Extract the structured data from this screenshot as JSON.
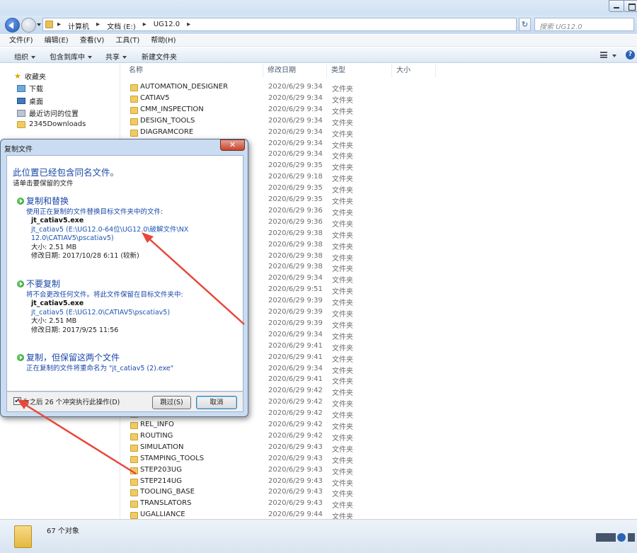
{
  "window": {
    "breadcrumb": [
      "计算机",
      "文档 (E:)",
      "UG12.0"
    ],
    "search_placeholder": "搜索 UG12.0"
  },
  "menu": [
    "文件(F)",
    "编辑(E)",
    "查看(V)",
    "工具(T)",
    "帮助(H)"
  ],
  "toolbar": {
    "organize": "组织",
    "include": "包含到库中",
    "share": "共享",
    "new_folder": "新建文件夹"
  },
  "nav": {
    "favorites": "收藏夹",
    "items": [
      "下载",
      "桌面",
      "最近访问的位置",
      "2345Downloads"
    ]
  },
  "columns": {
    "name": "名称",
    "date": "修改日期",
    "type": "类型",
    "size": "大小"
  },
  "files": [
    {
      "name": "AUTOMATION_DESIGNER",
      "date": "2020/6/29 9:34",
      "type": "文件夹"
    },
    {
      "name": "CATIAV5",
      "date": "2020/6/29 9:34",
      "type": "文件夹"
    },
    {
      "name": "CMM_INSPECTION",
      "date": "2020/6/29 9:34",
      "type": "文件夹"
    },
    {
      "name": "DESIGN_TOOLS",
      "date": "2020/6/29 9:34",
      "type": "文件夹"
    },
    {
      "name": "DIAGRAMCORE",
      "date": "2020/6/29 9:34",
      "type": "文件夹"
    },
    {
      "name": "",
      "date": "2020/6/29 9:34",
      "type": "文件夹"
    },
    {
      "name": "",
      "date": "2020/6/29 9:34",
      "type": "文件夹"
    },
    {
      "name": "",
      "date": "2020/6/29 9:35",
      "type": "文件夹"
    },
    {
      "name": "",
      "date": "2020/6/29 9:18",
      "type": "文件夹"
    },
    {
      "name": "",
      "date": "2020/6/29 9:35",
      "type": "文件夹"
    },
    {
      "name": "",
      "date": "2020/6/29 9:35",
      "type": "文件夹"
    },
    {
      "name": "",
      "date": "2020/6/29 9:36",
      "type": "文件夹"
    },
    {
      "name": "",
      "date": "2020/6/29 9:36",
      "type": "文件夹"
    },
    {
      "name": "",
      "date": "2020/6/29 9:38",
      "type": "文件夹"
    },
    {
      "name": "",
      "date": "2020/6/29 9:38",
      "type": "文件夹"
    },
    {
      "name": "",
      "date": "2020/6/29 9:38",
      "type": "文件夹"
    },
    {
      "name": "",
      "date": "2020/6/29 9:38",
      "type": "文件夹"
    },
    {
      "name": "",
      "date": "2020/6/29 9:34",
      "type": "文件夹"
    },
    {
      "name": "",
      "date": "2020/6/29 9:51",
      "type": "文件夹"
    },
    {
      "name": "",
      "date": "2020/6/29 9:39",
      "type": "文件夹"
    },
    {
      "name": "",
      "date": "2020/6/29 9:39",
      "type": "文件夹"
    },
    {
      "name": "",
      "date": "2020/6/29 9:39",
      "type": "文件夹"
    },
    {
      "name": "",
      "date": "2020/6/29 9:34",
      "type": "文件夹"
    },
    {
      "name": "",
      "date": "2020/6/29 9:41",
      "type": "文件夹"
    },
    {
      "name": "",
      "date": "2020/6/29 9:41",
      "type": "文件夹"
    },
    {
      "name": "",
      "date": "2020/6/29 9:34",
      "type": "文件夹"
    },
    {
      "name": "",
      "date": "2020/6/29 9:41",
      "type": "文件夹"
    },
    {
      "name": "",
      "date": "2020/6/29 9:42",
      "type": "文件夹"
    },
    {
      "name": "",
      "date": "2020/6/29 9:42",
      "type": "文件夹"
    },
    {
      "name": "",
      "date": "2020/6/29 9:42",
      "type": "文件夹"
    },
    {
      "name": "REL_INFO",
      "date": "2020/6/29 9:42",
      "type": "文件夹"
    },
    {
      "name": "ROUTING",
      "date": "2020/6/29 9:42",
      "type": "文件夹"
    },
    {
      "name": "SIMULATION",
      "date": "2020/6/29 9:43",
      "type": "文件夹"
    },
    {
      "name": "STAMPING_TOOLS",
      "date": "2020/6/29 9:43",
      "type": "文件夹"
    },
    {
      "name": "STEP203UG",
      "date": "2020/6/29 9:43",
      "type": "文件夹"
    },
    {
      "name": "STEP214UG",
      "date": "2020/6/29 9:43",
      "type": "文件夹"
    },
    {
      "name": "TOOLING_BASE",
      "date": "2020/6/29 9:43",
      "type": "文件夹"
    },
    {
      "name": "TRANSLATORS",
      "date": "2020/6/29 9:43",
      "type": "文件夹"
    },
    {
      "name": "UGALLIANCE",
      "date": "2020/6/29 9:44",
      "type": "文件夹"
    }
  ],
  "status": {
    "count": "67 个对象"
  },
  "dialog": {
    "title": "复制文件",
    "heading": "此位置已经包含同名文件。",
    "subheading": "请单击要保留的文件",
    "option1": {
      "title": "复制和替换",
      "desc": "使用正在复制的文件替换目标文件夹中的文件:",
      "file": "jt_catiav5.exe",
      "path": "jt_catiav5 (E:\\UG12.0-64位\\UG12.0\\破解文件\\NX 12.0\\CATIAV5\\pscatiav5)",
      "size": "大小: 2.51 MB",
      "date": "修改日期: 2017/10/28 6:11 (较新)"
    },
    "option2": {
      "title": "不要复制",
      "desc": "将不会更改任何文件。将此文件保留在目标文件夹中:",
      "file": "jt_catiav5.exe",
      "path": "jt_catiav5 (E:\\UG12.0\\CATIAV5\\pscatiav5)",
      "size": "大小: 2.51 MB",
      "date": "修改日期: 2017/9/25 11:56"
    },
    "option3": {
      "title": "复制，但保留这两个文件",
      "desc": "正在复制的文件将重命名为 \"jt_catiav5 (2).exe\""
    },
    "checkbox_label": "为之后 26 个冲突执行此操作(D)",
    "checkbox_checked": "✔",
    "skip": "跳过(S)",
    "cancel": "取消"
  }
}
